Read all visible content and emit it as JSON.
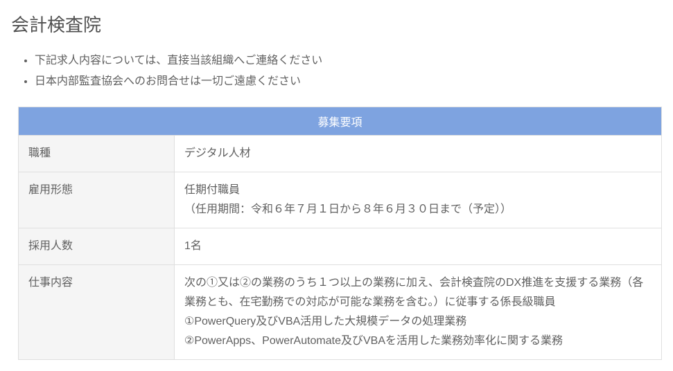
{
  "title": "会計検査院",
  "notes": [
    "下記求人内容については、直接当該組織へご連絡ください",
    "日本内部監査協会へのお問合せは一切ご遠慮ください"
  ],
  "table": {
    "header": "募集要項",
    "rows": [
      {
        "label": "職種",
        "value": "デジタル人材"
      },
      {
        "label": "雇用形態",
        "value": "任期付職員\n（任用期間：令和６年７月１日から８年６月３０日まで（予定））"
      },
      {
        "label": "採用人数",
        "value": "1名"
      },
      {
        "label": "仕事内容",
        "value": "次の①又は②の業務のうち１つ以上の業務に加え、会計検査院のDX推進を支援する業務（各業務とも、在宅勤務での対応が可能な業務を含む。）に従事する係長級職員\n①PowerQuery及びVBA活用した大規模データの処理業務\n②PowerApps、PowerAutomate及びVBAを活用した業務効率化に関する業務"
      }
    ]
  }
}
